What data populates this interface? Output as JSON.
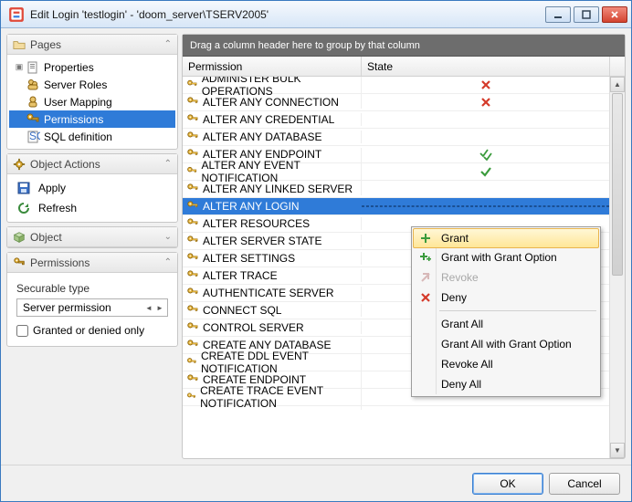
{
  "window": {
    "title": "Edit Login 'testlogin' - 'doom_server\\TSERV2005'"
  },
  "panels": {
    "pages": "Pages",
    "objectActions": "Object Actions",
    "object": "Object",
    "permissions": "Permissions"
  },
  "pages": {
    "items": [
      {
        "label": "Properties"
      },
      {
        "label": "Server Roles"
      },
      {
        "label": "User Mapping"
      },
      {
        "label": "Permissions",
        "selected": true
      },
      {
        "label": "SQL definition"
      }
    ]
  },
  "actions": {
    "apply": "Apply",
    "refresh": "Refresh"
  },
  "permPanel": {
    "securableTypeLabel": "Securable type",
    "securableTypeValue": "Server permission",
    "grantedOnly": "Granted or denied only"
  },
  "grid": {
    "groupHint": "Drag a column header here to group by that column",
    "col1": "Permission",
    "col2": "State",
    "rows": [
      {
        "perm": "ADMINISTER BULK OPERATIONS",
        "state": "deny"
      },
      {
        "perm": "ALTER ANY CONNECTION",
        "state": "deny"
      },
      {
        "perm": "ALTER ANY CREDENTIAL",
        "state": ""
      },
      {
        "perm": "ALTER ANY DATABASE",
        "state": ""
      },
      {
        "perm": "ALTER ANY ENDPOINT",
        "state": "grantopt"
      },
      {
        "perm": "ALTER ANY EVENT NOTIFICATION",
        "state": "grant"
      },
      {
        "perm": "ALTER ANY LINKED SERVER",
        "state": ""
      },
      {
        "perm": "ALTER ANY LOGIN",
        "state": "",
        "selected": true
      },
      {
        "perm": "ALTER RESOURCES",
        "state": ""
      },
      {
        "perm": "ALTER SERVER STATE",
        "state": ""
      },
      {
        "perm": "ALTER SETTINGS",
        "state": ""
      },
      {
        "perm": "ALTER TRACE",
        "state": ""
      },
      {
        "perm": "AUTHENTICATE SERVER",
        "state": ""
      },
      {
        "perm": "CONNECT SQL",
        "state": ""
      },
      {
        "perm": "CONTROL SERVER",
        "state": ""
      },
      {
        "perm": "CREATE ANY DATABASE",
        "state": ""
      },
      {
        "perm": "CREATE DDL EVENT NOTIFICATION",
        "state": ""
      },
      {
        "perm": "CREATE ENDPOINT",
        "state": ""
      },
      {
        "perm": "CREATE TRACE EVENT NOTIFICATION",
        "state": ""
      }
    ]
  },
  "menu": {
    "grant": "Grant",
    "grantOpt": "Grant with Grant Option",
    "revoke": "Revoke",
    "deny": "Deny",
    "grantAll": "Grant All",
    "grantAllOpt": "Grant All with Grant Option",
    "revokeAll": "Revoke All",
    "denyAll": "Deny All"
  },
  "footer": {
    "ok": "OK",
    "cancel": "Cancel"
  }
}
